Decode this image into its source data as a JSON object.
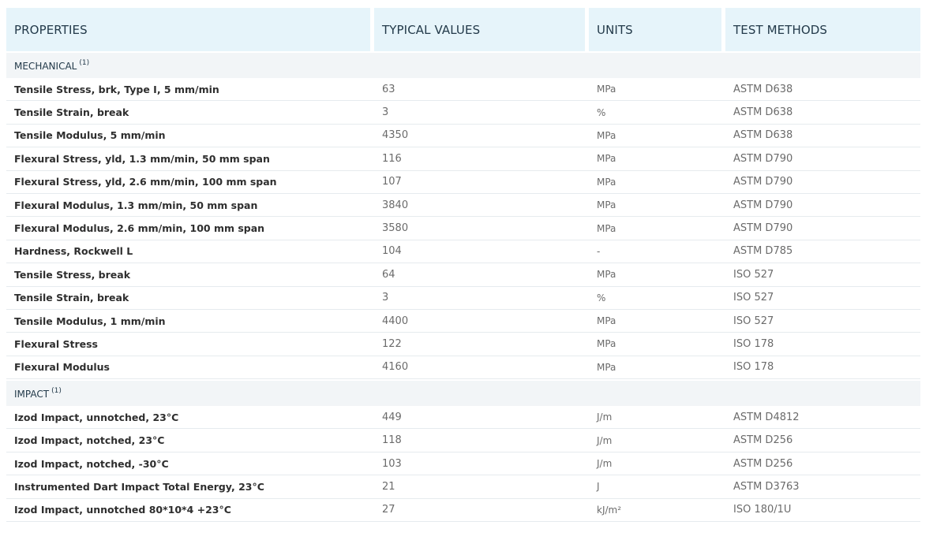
{
  "table": {
    "headers": [
      "PROPERTIES",
      "TYPICAL VALUES",
      "UNITS",
      "TEST METHODS"
    ],
    "sections": [
      {
        "title": "MECHANICAL",
        "note": "(1)",
        "rows": [
          {
            "property": "Tensile Stress, brk, Type I, 5 mm/min",
            "value": "63",
            "unit": "MPa",
            "method": "ASTM D638"
          },
          {
            "property": "Tensile Strain, break",
            "value": "3",
            "unit": "%",
            "method": "ASTM D638"
          },
          {
            "property": "Tensile Modulus, 5 mm/min",
            "value": "4350",
            "unit": "MPa",
            "method": "ASTM D638"
          },
          {
            "property": "Flexural Stress, yld, 1.3 mm/min, 50 mm span",
            "value": "116",
            "unit": "MPa",
            "method": "ASTM D790"
          },
          {
            "property": "Flexural Stress, yld, 2.6 mm/min, 100 mm span",
            "value": "107",
            "unit": "MPa",
            "method": "ASTM D790"
          },
          {
            "property": "Flexural Modulus, 1.3 mm/min, 50 mm span",
            "value": "3840",
            "unit": "MPa",
            "method": "ASTM D790"
          },
          {
            "property": "Flexural Modulus, 2.6 mm/min, 100 mm span",
            "value": "3580",
            "unit": "MPa",
            "method": "ASTM D790"
          },
          {
            "property": "Hardness, Rockwell L",
            "value": "104",
            "unit": "-",
            "method": "ASTM D785"
          },
          {
            "property": "Tensile Stress, break",
            "value": "64",
            "unit": "MPa",
            "method": "ISO 527"
          },
          {
            "property": "Tensile Strain, break",
            "value": "3",
            "unit": "%",
            "method": "ISO 527"
          },
          {
            "property": "Tensile Modulus, 1 mm/min",
            "value": "4400",
            "unit": "MPa",
            "method": "ISO 527"
          },
          {
            "property": "Flexural Stress",
            "value": "122",
            "unit": "MPa",
            "method": "ISO 178"
          },
          {
            "property": "Flexural Modulus",
            "value": "4160",
            "unit": "MPa",
            "method": "ISO 178"
          }
        ]
      },
      {
        "title": "IMPACT",
        "note": "(1)",
        "rows": [
          {
            "property": "Izod Impact, unnotched, 23°C",
            "value": "449",
            "unit": "J/m",
            "method": "ASTM D4812"
          },
          {
            "property": "Izod Impact, notched, 23°C",
            "value": "118",
            "unit": "J/m",
            "method": "ASTM D256"
          },
          {
            "property": "Izod Impact, notched, -30°C",
            "value": "103",
            "unit": "J/m",
            "method": "ASTM D256"
          },
          {
            "property": "Instrumented Dart Impact Total Energy, 23°C",
            "value": "21",
            "unit": "J",
            "method": "ASTM D3763"
          },
          {
            "property": "Izod Impact, unnotched 80*10*4 +23°C",
            "value": "27",
            "unit": "kJ/m²",
            "method": "ISO 180/1U"
          }
        ]
      }
    ]
  }
}
